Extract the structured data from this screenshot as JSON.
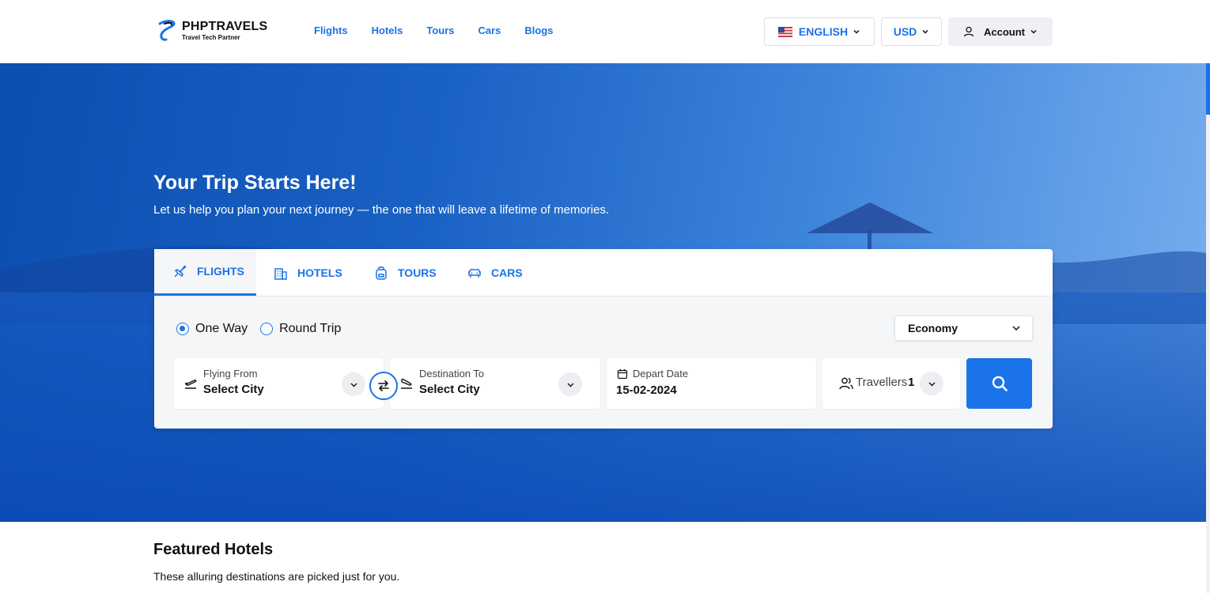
{
  "brand": {
    "name": "PHPTRAVELS",
    "tagline": "Travel Tech Partner"
  },
  "nav": [
    "Flights",
    "Hotels",
    "Tours",
    "Cars",
    "Blogs"
  ],
  "header": {
    "language": "ENGLISH",
    "currency": "USD",
    "account": "Account"
  },
  "hero": {
    "title": "Your Trip Starts Here!",
    "subtitle": "Let us help you plan your next journey — the one that will leave a lifetime of memories."
  },
  "search": {
    "tabs": [
      "FLIGHTS",
      "HOTELS",
      "TOURS",
      "CARS"
    ],
    "active_tab": "FLIGHTS",
    "trip_types": [
      "One Way",
      "Round Trip"
    ],
    "selected_trip_type": "One Way",
    "cabin_class": "Economy",
    "from": {
      "label": "Flying From",
      "value": "Select City"
    },
    "to": {
      "label": "Destination To",
      "value": "Select City"
    },
    "depart": {
      "label": "Depart Date",
      "value": "15-02-2024"
    },
    "travellers": {
      "label": "Travellers",
      "count": "1"
    }
  },
  "featured": {
    "title": "Featured Hotels",
    "subtitle": "These alluring destinations are picked just for you."
  },
  "colors": {
    "accent": "#1a73e8",
    "hero_dark": "#0b4fb0",
    "hero_light": "#7ab0ee"
  }
}
